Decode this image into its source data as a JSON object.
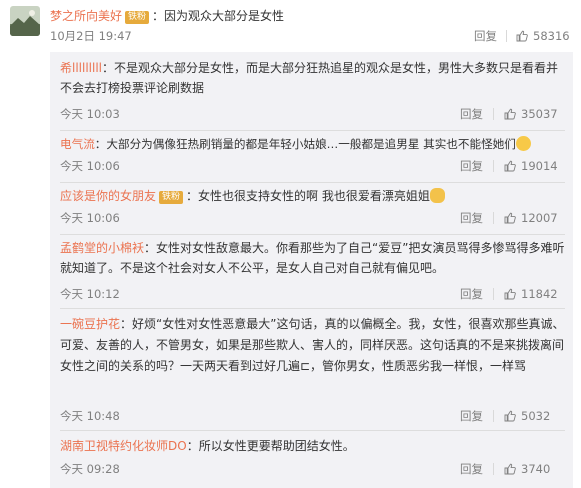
{
  "main_comment": {
    "username": "梦之所向美好",
    "badge": "铁粉",
    "text": "：因为观众大部分是女性",
    "date": "10月2日 19:47",
    "reply_label": "回复",
    "like_count": "58316"
  },
  "replies": [
    {
      "username": "希lllllllll",
      "badge": "",
      "text": "：不是观众大部分是女性，而是大部分狂热追星的观众是女性，男性大多数只是看看并不会去打榜投票评论刷数据",
      "time": "今天 10:03",
      "reply_label": "回复",
      "like_count": "35037"
    },
    {
      "username": "电气流",
      "badge": "",
      "text": "：大部分为偶像狂热刷销量的都是年轻小姑娘…一般都是追男星 其实也不能怪她们",
      "time": "今天 10:06",
      "reply_label": "回复",
      "like_count": "19014",
      "emoji": "sweat-smile-emoji"
    },
    {
      "username": "应该是你的女朋友",
      "badge": "铁粉",
      "text": "：女性也很支持女性的啊 我也很爱看漂亮姐姐",
      "time": "今天 10:06",
      "reply_label": "回复",
      "like_count": "12007",
      "emoji": "cat-face-emoji"
    },
    {
      "username": "孟鹤堂的小棉袄",
      "badge": "",
      "text": "：女性对女性敌意最大。你看那些为了自己“爱豆”把女演员骂得多惨骂得多难听就知道了。不是这个社会对女人不公平，是女人自己对自己就有偏见吧。",
      "time": "今天 10:12",
      "reply_label": "回复",
      "like_count": "11842"
    },
    {
      "username": "一碗豆护花",
      "badge": "",
      "text": "：好烦“女性对女性恶意最大”这句话，真的以偏概全。我，女性，很喜欢那些真诚、可爱、友善的人，不管男女，如果是那些欺人、害人的，同样厌恶。这句话真的不是来挑拨离间女性之间的关系的吗？一天两天看到过好几遍⊏，管你男女，性质恶劣我一样恨，一样骂",
      "time": "今天 10:48",
      "reply_label": "回复",
      "like_count": "5032"
    },
    {
      "username": "湖南卫视特约化妆师DO",
      "badge": "",
      "text": "：所以女性更要帮助团结女性。",
      "time": "今天 09:28",
      "reply_label": "回复",
      "like_count": "3740"
    }
  ],
  "colors": {
    "username": "#eb7350",
    "badge": "#e6aa3c",
    "reply_bg": "#f2f2f5",
    "meta": "#808080"
  }
}
